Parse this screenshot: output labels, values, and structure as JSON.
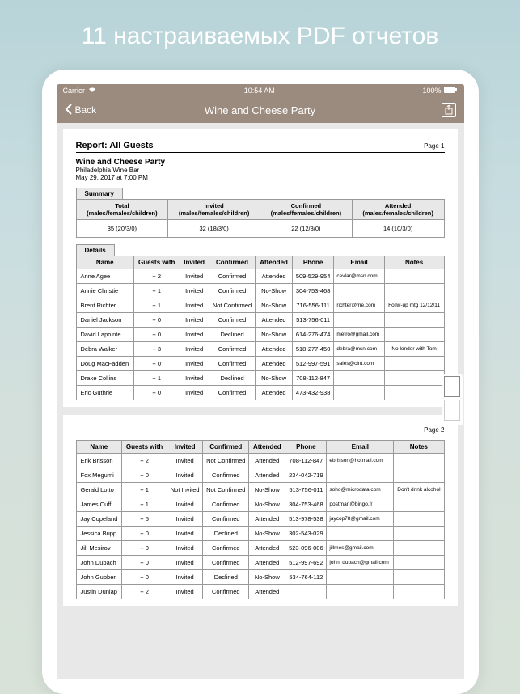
{
  "banner": "11 настраиваемых PDF отчетов",
  "status": {
    "carrier": "Carrier",
    "time": "10:54 AM",
    "battery": "100%"
  },
  "nav": {
    "back": "Back",
    "title": "Wine and Cheese Party"
  },
  "report": {
    "title": "Report: All Guests",
    "page1": "Page 1",
    "page2": "Page 2",
    "event": "Wine and Cheese Party",
    "venue": "Philadelphia Wine Bar",
    "datetime": "May 29, 2017 at 7:00 PM"
  },
  "summary_tab": "Summary",
  "summary_headers": [
    "Total\n(males/females/children)",
    "Invited\n(males/females/children)",
    "Confirmed\n(males/females/children)",
    "Attended\n(males/females/children)"
  ],
  "summary_values": [
    "35 (20/3/0)",
    "32 (18/3/0)",
    "22 (12/3/0)",
    "14 (10/3/0)"
  ],
  "details_tab": "Details",
  "details_headers": [
    "Name",
    "Guests with",
    "Invited",
    "Confirmed",
    "Attended",
    "Phone",
    "Email",
    "Notes"
  ],
  "rows1": [
    [
      "Anne Agee",
      "+ 2",
      "Invited",
      "Confirmed",
      "Attended",
      "509-529-954",
      "cevlar@msn.com",
      ""
    ],
    [
      "Annie Christie",
      "+ 1",
      "Invited",
      "Confirmed",
      "No-Show",
      "304-753-468",
      "",
      ""
    ],
    [
      "Brent Richter",
      "+ 1",
      "Invited",
      "Not Confirmed",
      "No-Show",
      "716-556-111",
      "richter@me.com",
      "Follw-up mtg 12/12/11"
    ],
    [
      "Daniel Jackson",
      "+ 0",
      "Invited",
      "Confirmed",
      "Attended",
      "513-756-011",
      "",
      ""
    ],
    [
      "David Lapointe",
      "+ 0",
      "Invited",
      "Declined",
      "No-Show",
      "614-276-474",
      "metro@gmail.com",
      ""
    ],
    [
      "Debra Walker",
      "+ 3",
      "Invited",
      "Confirmed",
      "Attended",
      "518-277-450",
      "debra@msn.com",
      "No londer with Tom"
    ],
    [
      "Doug MacFadden",
      "+ 0",
      "Invited",
      "Confirmed",
      "Attended",
      "512-997-591",
      "sales@clnt.com",
      ""
    ],
    [
      "Drake Collins",
      "+ 1",
      "Invited",
      "Declined",
      "No-Show",
      "708-112-847",
      "",
      ""
    ],
    [
      "Eric Guthrie",
      "+ 0",
      "Invited",
      "Confirmed",
      "Attended",
      "473-432-938",
      "",
      ""
    ]
  ],
  "rows2": [
    [
      "Erik Brisson",
      "+ 2",
      "Invited",
      "Not Confirmed",
      "Attended",
      "708-112-847",
      "ebrisson@hotmail.com",
      ""
    ],
    [
      "Fox Megumi",
      "+ 0",
      "Invited",
      "Confirmed",
      "Attended",
      "234-042-719",
      "",
      ""
    ],
    [
      "Gerald Lotto",
      "+ 1",
      "Not Invited",
      "Not Confirmed",
      "No-Show",
      "513-756-011",
      "soho@microdata.com",
      "Don't drink alcohol"
    ],
    [
      "James Cuff",
      "+ 1",
      "Invited",
      "Confirmed",
      "No-Show",
      "304-753-468",
      "postman@bingo.fr",
      ""
    ],
    [
      "Jay Copeland",
      "+ 5",
      "Invited",
      "Confirmed",
      "Attended",
      "513-978-538",
      "jaycop78@gmail.com",
      ""
    ],
    [
      "Jessica Bupp",
      "+ 0",
      "Invited",
      "Declined",
      "No-Show",
      "302-543-029",
      "",
      ""
    ],
    [
      "Jill Mesirov",
      "+ 0",
      "Invited",
      "Confirmed",
      "Attended",
      "523-096-006",
      "jillmes@gmail.com",
      ""
    ],
    [
      "John Dubach",
      "+ 0",
      "Invited",
      "Confirmed",
      "Attended",
      "512-997-692",
      "john_dubach@gmail.com",
      ""
    ],
    [
      "John Gubben",
      "+ 0",
      "Invited",
      "Declined",
      "No-Show",
      "534-764-112",
      "",
      ""
    ],
    [
      "Justin Dunlap",
      "+ 2",
      "Invited",
      "Confirmed",
      "Attended",
      "",
      "",
      ""
    ]
  ]
}
